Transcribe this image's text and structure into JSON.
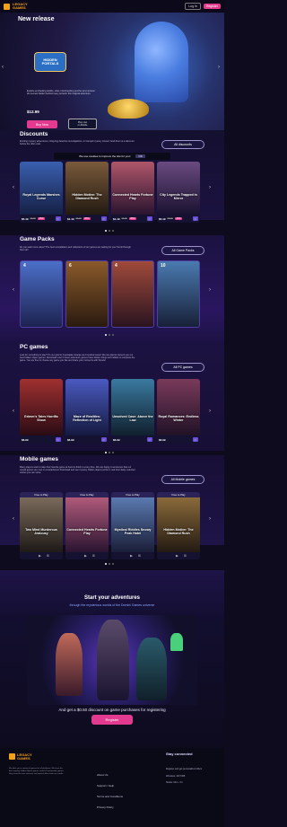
{
  "header": {
    "logo_line1": "LEGACY",
    "logo_line2": "GAMES",
    "login": "Log In",
    "register": "Register"
  },
  "hero": {
    "title": "New release",
    "game_logo": "HIDDEN PORTALS",
    "description": "Explore enchanting worlds, solve mind-bending puzzles and uncover the secrets hidden behind every portal in this magical adventure.",
    "price": "$12.99",
    "buy": "Buy Now",
    "mobile_line1": "Play now",
    "mobile_line2": "on Mobile"
  },
  "discounts": {
    "title": "Discounts",
    "desc": "Exciting mystery adventures, intriguing detective investigations, or tranquil mystery stories! Grab them at a discount before the offer ends.",
    "all": "All discounts",
    "cookie": "We use cookies to improve the site for you!",
    "cookie_ok": "OK",
    "cards": [
      {
        "title": "Royal Legends Marshes Curse",
        "price": "$5.49",
        "old": "$9.99",
        "disc": "-45%",
        "color1": "#3a5fb0",
        "color2": "#152045"
      },
      {
        "title": "Hidden Motive: The Diamond Rush",
        "price": "$1.49",
        "old": "$9.99",
        "disc": "-85%",
        "color1": "#7a5a3a",
        "color2": "#231a12"
      },
      {
        "title": "Connected Hearts Fortune Play",
        "price": "$1.49",
        "old": "$9.99",
        "disc": "-85%",
        "color1": "#b0566a",
        "color2": "#2a1430"
      },
      {
        "title": "City Legends Trapped in Mirror",
        "price": "$5.49",
        "old": "$9.99",
        "disc": "-45%",
        "color1": "#6a4a80",
        "color2": "#1a1230"
      }
    ]
  },
  "packs": {
    "title": "Game Packs",
    "desc": "Do you want more value? The best compilations and collections of our games are waiting for you! Scroll through them all!",
    "all": "All Game Packs",
    "items": [
      {
        "num": "4",
        "color1": "#4b6fc8",
        "color2": "#1d2250"
      },
      {
        "num": "6",
        "color1": "#8a5a2a",
        "color2": "#2a1a10"
      },
      {
        "num": "4",
        "color1": "#a04a3a",
        "color2": "#2a1420"
      },
      {
        "num": "10",
        "color1": "#4a7ab0",
        "color2": "#182038"
      }
    ]
  },
  "pc": {
    "title": "PC games",
    "desc": "Look for something to play? It's our goal to investigate strange and mystical cases! We are glad to present you our best hidden object games. Download now! If these adventure games have hidden things and riddles to complete the game. You are free to choose any game you like and share your moments with friends!",
    "all": "All PC games",
    "cards": [
      {
        "title": "Grimm's Tales Horrific Show",
        "price": "$6.99",
        "color1": "#a03030",
        "color2": "#2a0c14"
      },
      {
        "title": "Maze of Realities: Reflection of Light",
        "price": "$6.99",
        "color1": "#4a5ac0",
        "color2": "#151a40"
      },
      {
        "title": "Unsolved Case: Above the Law",
        "price": "$6.99",
        "color1": "#3a7aa0",
        "color2": "#10202e"
      },
      {
        "title": "Royal Romances: Endless Winter",
        "price": "$6.99",
        "color1": "#7a3a5a",
        "color2": "#201226"
      }
    ]
  },
  "mobile": {
    "title": "Mobile games",
    "desc": "Many players want to take their favorite game at hand to finish it at any time. We are happy to announce that our casual games are now on smartphones! Download and see mystery hidden object puzzle in real time! Easy selected stories you can solve.",
    "all": "All Mobile games",
    "ftp": "Free to Play",
    "cards": [
      {
        "title": "Two Mind Murderous Jealousy",
        "color1": "#7a6a5a",
        "color2": "#1e1a18"
      },
      {
        "title": "Connected Hearts Fortune Play",
        "color1": "#b05a7a",
        "color2": "#2a1430"
      },
      {
        "title": "Mystical Riddles Snowy Peak Hotel",
        "color1": "#5a7ab0",
        "color2": "#1a1e38"
      },
      {
        "title": "Hidden Motive: The Diamond Rush",
        "color1": "#8a6a3a",
        "color2": "#231a12"
      }
    ]
  },
  "promo": {
    "title": "Start your adventures",
    "subtitle": "through the mysterious worlds of the Domini Games universe",
    "bonus": "And get a $0.50 discount on game purchases for registering",
    "register": "Register"
  },
  "footer": {
    "logo_line1": "LEGACY",
    "logo_line2": "GAMES",
    "desc": "We offer you a variety of games for all platforms. We have the best mystery hidden object games, match-3 and puzzle games. Stay tuned for new releases and special offers from our studio.",
    "links": [
      "About Us",
      "Support / Help",
      "Terms and Conditions",
      "Privacy Policy"
    ],
    "stay": "Stay connected",
    "contact1": "Register and get personalized offers",
    "contact2": "Windows: 24/7/365",
    "contact3": "Studio: Mon - Fri"
  }
}
